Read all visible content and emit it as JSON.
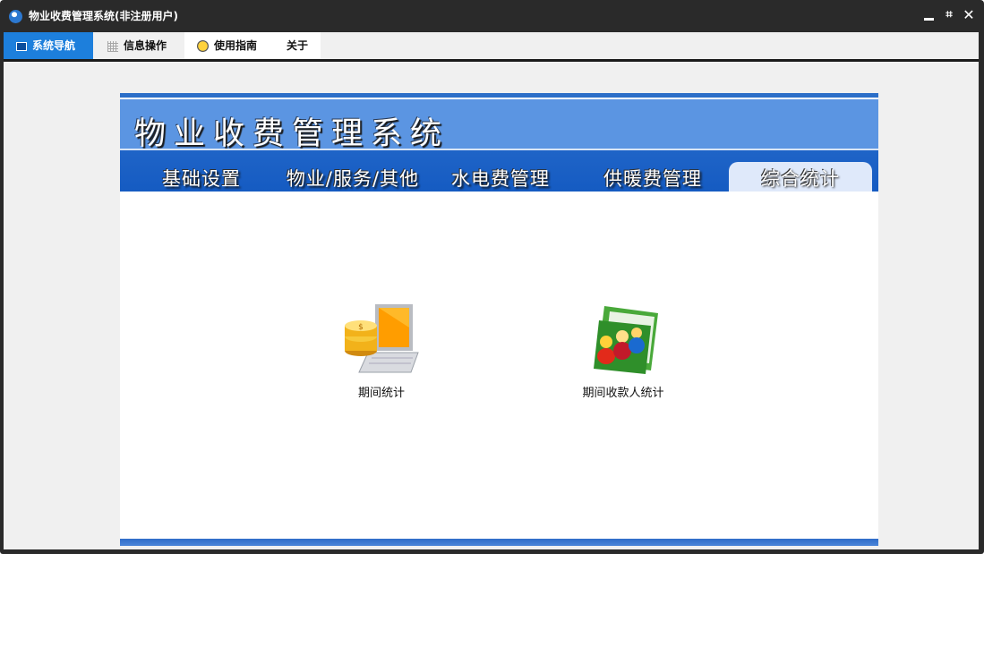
{
  "window": {
    "title": "物业收费管理系统(非注册用户)",
    "controls": {
      "minimize": "",
      "restore": "⌗",
      "close": "✕"
    }
  },
  "menu": {
    "items": [
      {
        "label": "系统导航",
        "icon": "monitor-icon",
        "active": true
      },
      {
        "label": "信息操作",
        "icon": "grid-icon"
      },
      {
        "label": "使用指南",
        "icon": "help-globe-icon"
      },
      {
        "label": "关于"
      }
    ]
  },
  "panel": {
    "title": "物业收费管理系统",
    "tabs": [
      {
        "label": "基础设置"
      },
      {
        "label": "物业/服务/其他"
      },
      {
        "label": "水电费管理"
      },
      {
        "label": "供暖费管理"
      },
      {
        "label": "综合统计",
        "selected": true
      }
    ],
    "launchers": [
      {
        "label": "期间统计",
        "icon": "coins-laptop-icon"
      },
      {
        "label": "期间收款人统计",
        "icon": "people-folder-icon"
      }
    ]
  },
  "colors": {
    "menu_active": "#1d7fdc",
    "banner_blue": "#5b95e2",
    "tabbar_blue": "#155bc2",
    "selected_tab": "#dfe9fa"
  }
}
